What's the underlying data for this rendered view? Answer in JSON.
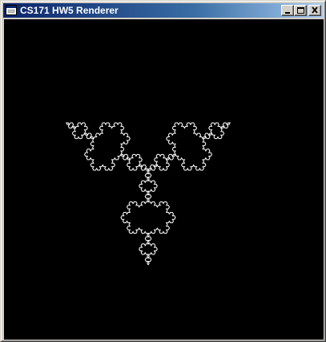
{
  "window": {
    "title": "CS171 HW5 Renderer",
    "buttons": {
      "minimize": "minimize",
      "maximize": "maximize",
      "close": "close"
    }
  },
  "canvas": {
    "background": "#000000",
    "shape": "koch-snowflake",
    "stroke": "#ffffff",
    "iterations": 4
  },
  "colors": {
    "titlebar_start": "#0a246a",
    "titlebar_end": "#a6caf0",
    "chrome": "#d4d0c8"
  }
}
